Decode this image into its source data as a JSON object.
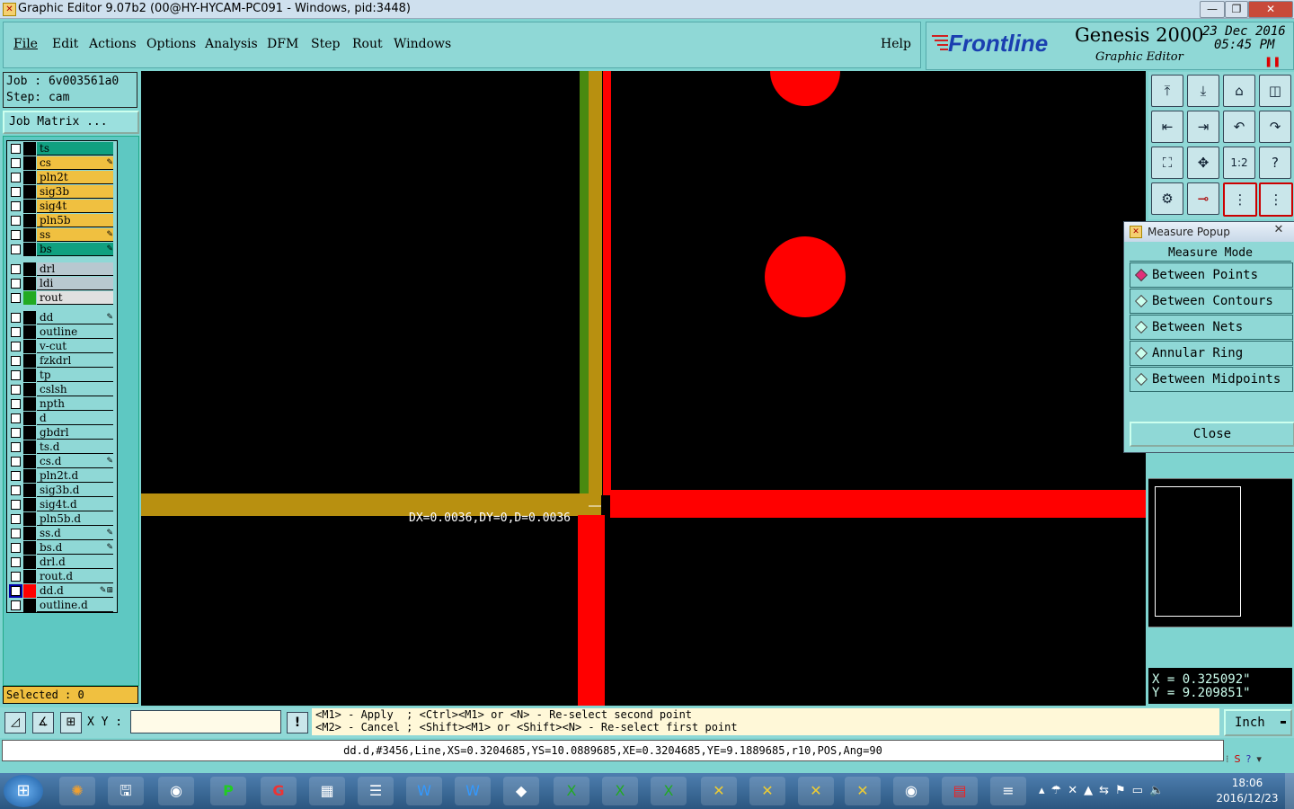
{
  "window": {
    "title": "Graphic Editor 9.07b2 (00@HY-HYCAM-PC091 - Windows, pid:3448)"
  },
  "menu": {
    "items": [
      "File",
      "Edit",
      "Actions",
      "Options",
      "Analysis",
      "DFM",
      "Step",
      "Rout",
      "Windows"
    ],
    "help": "Help"
  },
  "brand": {
    "logo": "Frontline",
    "product": "Genesis 2000",
    "subtitle": "Graphic Editor",
    "date": "23 Dec 2016",
    "time": "05:45 PM"
  },
  "job": {
    "job_label": "Job : 6v003561a0",
    "step_label": "Step: cam",
    "matrix_button": "Job Matrix ..."
  },
  "layers": [
    {
      "name": "ts",
      "bg": "#10a080",
      "sw": "#000",
      "ed": ""
    },
    {
      "name": "cs",
      "bg": "#f0c040",
      "sw": "#000",
      "ed": "✎"
    },
    {
      "name": "pln2t",
      "bg": "#f0c040",
      "sw": "#000",
      "ed": ""
    },
    {
      "name": "sig3b",
      "bg": "#f0c040",
      "sw": "#000",
      "ed": ""
    },
    {
      "name": "sig4t",
      "bg": "#f0c040",
      "sw": "#000",
      "ed": ""
    },
    {
      "name": "pln5b",
      "bg": "#f0c040",
      "sw": "#000",
      "ed": ""
    },
    {
      "name": "ss",
      "bg": "#f0c040",
      "sw": "#000",
      "ed": "✎"
    },
    {
      "name": "bs",
      "bg": "#10a080",
      "sw": "#000",
      "ed": "✎"
    },
    {
      "name": "drl",
      "bg": "#b8c8d0",
      "sw": "#000",
      "ed": ""
    },
    {
      "name": "ldi",
      "bg": "#b8c8d0",
      "sw": "#000",
      "ed": ""
    },
    {
      "name": "rout",
      "bg": "#e0e0e0",
      "sw": "#22aa22",
      "ed": ""
    },
    {
      "name": "dd",
      "bg": "#8fd8d6",
      "sw": "#000",
      "ed": "✎"
    },
    {
      "name": "outline",
      "bg": "#8fd8d6",
      "sw": "#000",
      "ed": ""
    },
    {
      "name": "v-cut",
      "bg": "#8fd8d6",
      "sw": "#000",
      "ed": ""
    },
    {
      "name": "fzkdrl",
      "bg": "#8fd8d6",
      "sw": "#000",
      "ed": ""
    },
    {
      "name": "tp",
      "bg": "#8fd8d6",
      "sw": "#000",
      "ed": ""
    },
    {
      "name": "cslsh",
      "bg": "#8fd8d6",
      "sw": "#000",
      "ed": ""
    },
    {
      "name": "npth",
      "bg": "#8fd8d6",
      "sw": "#000",
      "ed": ""
    },
    {
      "name": "d",
      "bg": "#8fd8d6",
      "sw": "#000",
      "ed": ""
    },
    {
      "name": "gbdrl",
      "bg": "#8fd8d6",
      "sw": "#000",
      "ed": ""
    },
    {
      "name": "ts.d",
      "bg": "#8fd8d6",
      "sw": "#000",
      "ed": ""
    },
    {
      "name": "cs.d",
      "bg": "#8fd8d6",
      "sw": "#000",
      "ed": "✎"
    },
    {
      "name": "pln2t.d",
      "bg": "#8fd8d6",
      "sw": "#000",
      "ed": ""
    },
    {
      "name": "sig3b.d",
      "bg": "#8fd8d6",
      "sw": "#000",
      "ed": ""
    },
    {
      "name": "sig4t.d",
      "bg": "#8fd8d6",
      "sw": "#000",
      "ed": ""
    },
    {
      "name": "pln5b.d",
      "bg": "#8fd8d6",
      "sw": "#000",
      "ed": ""
    },
    {
      "name": "ss.d",
      "bg": "#8fd8d6",
      "sw": "#000",
      "ed": "✎"
    },
    {
      "name": "bs.d",
      "bg": "#8fd8d6",
      "sw": "#000",
      "ed": "✎"
    },
    {
      "name": "drl.d",
      "bg": "#8fd8d6",
      "sw": "#000",
      "ed": ""
    },
    {
      "name": "rout.d",
      "bg": "#8fd8d6",
      "sw": "#000",
      "ed": ""
    },
    {
      "name": "dd.d",
      "bg": "#8fd8d6",
      "sw": "#ff0000",
      "ed": "✎⊞"
    },
    {
      "name": "outline.d",
      "bg": "#8fd8d6",
      "sw": "#000",
      "ed": ""
    }
  ],
  "selected": "Selected : 0",
  "canvas": {
    "measure_text": "DX=0.0036,DY=0,D=0.0036"
  },
  "measure_popup": {
    "title": "Measure Popup",
    "heading": "Measure Mode",
    "options": [
      "Between Points",
      "Between Contours",
      "Between Nets",
      "Annular Ring",
      "Between Midpoints"
    ],
    "selected_index": 0,
    "close_label": "Close"
  },
  "coords": {
    "x": "X = 0.325092\"",
    "y": "Y = 9.209851\""
  },
  "cmd": {
    "xy_label": "X Y :",
    "xy_value": "",
    "hint1": "<M1> - Apply  ; <Ctrl><M1> or <N> - Re-select second point",
    "hint2": "<M2> - Cancel ; <Shift><M1> or <Shift><N> - Re-select first point",
    "units": "Inch"
  },
  "status_line": "dd.d,#3456,Line,XS=0.3204685,YS=10.0889685,XE=0.3204685,YE=9.1889685,r10,POS,Ang=90",
  "clock": {
    "time": "18:06",
    "date": "2016/12/23"
  }
}
